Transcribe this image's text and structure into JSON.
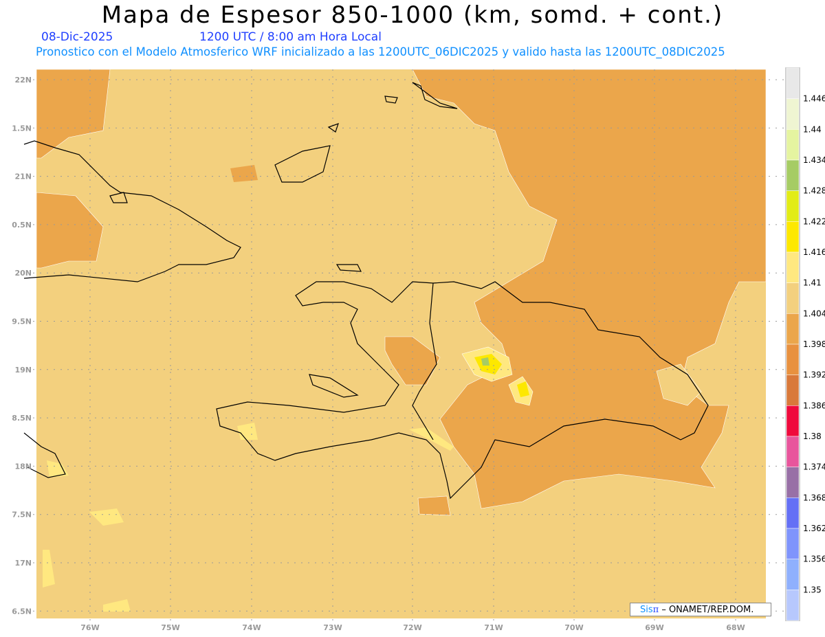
{
  "header": {
    "title": "Mapa de Espesor 850-1000 (km, somd. + cont.)",
    "date": "08-Dic-2025",
    "time": "1200 UTC / 8:00 am Hora Local",
    "subtitle": "Pronostico con el Modelo Atmosferico WRF inicializado a las 1200UTC_06DIC2025 y valido hasta las  1200UTC_08DIC2025"
  },
  "map": {
    "variable": "Espesor 850-1000",
    "units": "km",
    "lon_labels": [
      "76W",
      "75W",
      "74W",
      "73W",
      "72W",
      "71W",
      "70W",
      "69W",
      "68W"
    ],
    "lat_labels": [
      "22N",
      "1.5N",
      "21N",
      "0.5N",
      "20N",
      "9.5N",
      "19N",
      "8.5N",
      "18N",
      "7.5N",
      "17N",
      "6.5N"
    ],
    "grid": true,
    "background_color": "#f3d07e",
    "dominant_colors": {
      "1.398-1.404": "#eba64b",
      "1.404-1.41": "#f3d07e",
      "1.41-1.416": "#ffe880",
      "1.416-1.422": "#fde800",
      "1.428-1.434": "#a6cc64"
    }
  },
  "colorbar": {
    "labels": [
      "1.446",
      "1.44",
      "1.434",
      "1.428",
      "1.422",
      "1.416",
      "1.41",
      "1.404",
      "1.398",
      "1.392",
      "1.386",
      "1.38",
      "1.374",
      "1.368",
      "1.362",
      "1.356",
      "1.35"
    ],
    "colors": [
      "#e8e8e8",
      "#eff5d2",
      "#e5f4a0",
      "#a6cc64",
      "#e2ec16",
      "#fde800",
      "#ffe880",
      "#f3d07e",
      "#eba64b",
      "#e8913f",
      "#d9793a",
      "#ef0a3c",
      "#e8559c",
      "#9870a6",
      "#6470f5",
      "#7f94fc",
      "#8fb0fd",
      "#b7c8fd"
    ]
  },
  "watermark": {
    "brand_a": "Sis",
    "brand_b": "π",
    "text": " –  ONAMET/REP.DOM."
  }
}
